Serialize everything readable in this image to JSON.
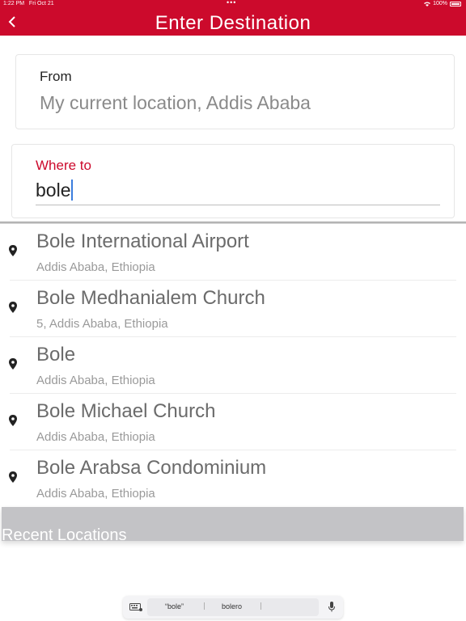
{
  "status_bar": {
    "time": "1:22 PM",
    "date": "Fri Oct 21",
    "dots": "•••",
    "battery": "100%"
  },
  "nav": {
    "title": "Enter Destination",
    "back_icon": "chevron-left-icon"
  },
  "from": {
    "label": "From",
    "value": "My current location, Addis Ababa"
  },
  "where": {
    "label": "Where to",
    "value": "bole"
  },
  "results": [
    {
      "title": "Bole International Airport",
      "subtitle": "Addis Ababa, Ethiopia"
    },
    {
      "title": "Bole Medhanialem Church",
      "subtitle": "5, Addis Ababa, Ethiopia"
    },
    {
      "title": "Bole",
      "subtitle": "Addis Ababa, Ethiopia"
    },
    {
      "title": "Bole Michael Church",
      "subtitle": "Addis Ababa, Ethiopia"
    },
    {
      "title": "Bole Arabsa Condominium",
      "subtitle": "Addis Ababa, Ethiopia"
    }
  ],
  "recent": {
    "label": "Recent Locations"
  },
  "keyboard": {
    "suggestions": [
      "“bole”",
      "bolero"
    ]
  },
  "colors": {
    "brand": "#cc0a2c",
    "cursor": "#3b7ddd"
  }
}
